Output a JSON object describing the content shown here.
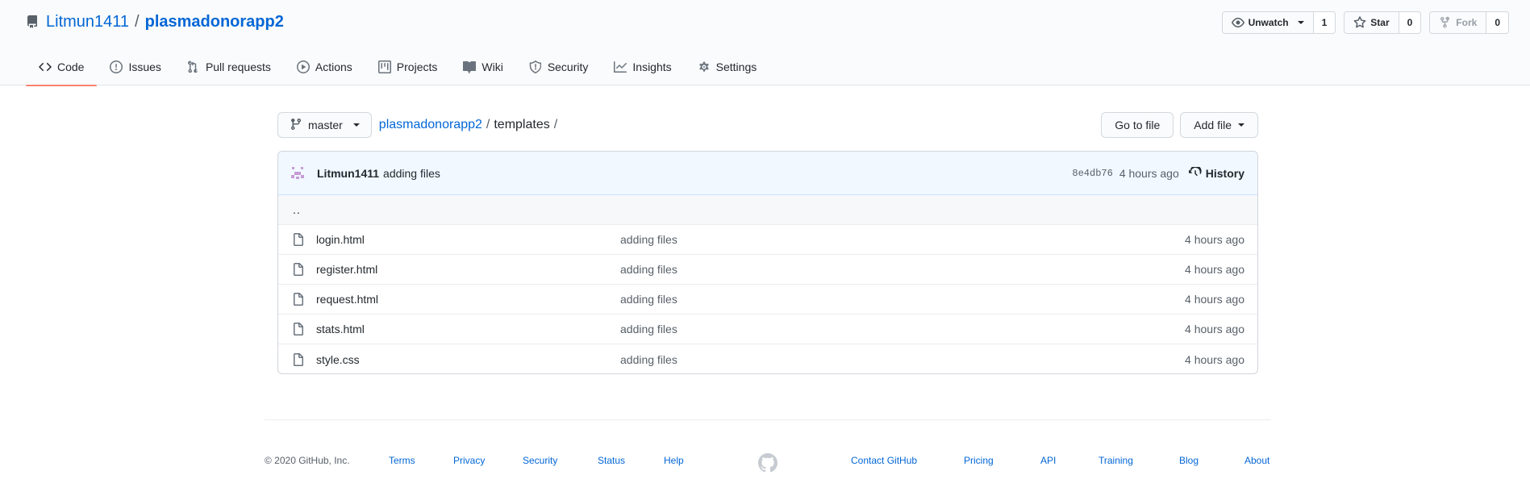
{
  "header": {
    "owner": "Litmun1411",
    "separator": "/",
    "repo": "plasmadonorapp2",
    "buttons": [
      {
        "label": "Unwatch",
        "count": "1",
        "icon": "eye-icon"
      },
      {
        "label": "Star",
        "count": "0",
        "icon": "star-icon"
      },
      {
        "label": "Fork",
        "count": "0",
        "icon": "fork-icon"
      }
    ],
    "tabs": [
      {
        "label": "Code",
        "icon": "code-icon",
        "selected": true
      },
      {
        "label": "Issues",
        "icon": "issue-icon"
      },
      {
        "label": "Pull requests",
        "icon": "pull-request-icon"
      },
      {
        "label": "Actions",
        "icon": "play-icon"
      },
      {
        "label": "Projects",
        "icon": "project-icon"
      },
      {
        "label": "Wiki",
        "icon": "book-icon"
      },
      {
        "label": "Security",
        "icon": "shield-icon"
      },
      {
        "label": "Insights",
        "icon": "graph-icon"
      },
      {
        "label": "Settings",
        "icon": "gear-icon"
      }
    ]
  },
  "filenav": {
    "branch": "master",
    "breadcrumb_root": "plasmadonorapp2",
    "slash": "/",
    "current_dir": "templates",
    "trailing_slash": "/",
    "go_to_file": "Go to file",
    "add_file": "Add file"
  },
  "commit": {
    "author": "Litmun1411",
    "message": "adding files",
    "sha": "8e4db76",
    "time": "4 hours ago",
    "history": "History"
  },
  "files": {
    "updir": "..",
    "rows": [
      {
        "name": "login.html",
        "message": "adding files",
        "time": "4 hours ago"
      },
      {
        "name": "register.html",
        "message": "adding files",
        "time": "4 hours ago"
      },
      {
        "name": "request.html",
        "message": "adding files",
        "time": "4 hours ago"
      },
      {
        "name": "stats.html",
        "message": "adding files",
        "time": "4 hours ago"
      },
      {
        "name": "style.css",
        "message": "adding files",
        "time": "4 hours ago"
      }
    ]
  },
  "footer": {
    "copyright": "© 2020 GitHub, Inc.",
    "left_links": [
      "Terms",
      "Privacy",
      "Security",
      "Status",
      "Help"
    ],
    "right_links": [
      "Contact GitHub",
      "Pricing",
      "API",
      "Training",
      "Blog",
      "About"
    ]
  },
  "colors": {
    "link": "#0366d6",
    "tab_underline": "#f9826c",
    "commit_bar": "#f1f8ff"
  }
}
